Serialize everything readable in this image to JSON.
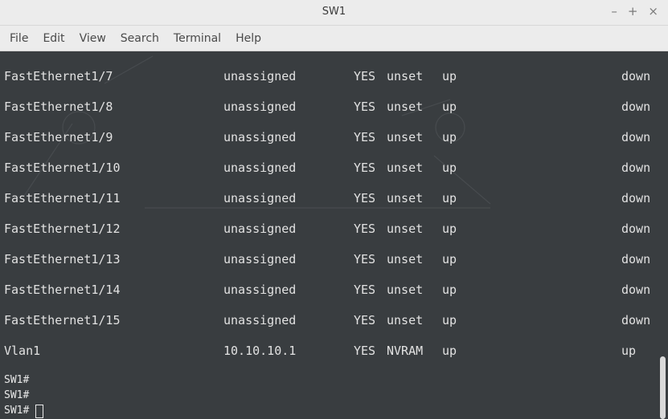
{
  "window": {
    "title": "SW1",
    "controls": {
      "minimize": "–",
      "maximize": "+",
      "close": "×"
    }
  },
  "menu": {
    "file": "File",
    "edit": "Edit",
    "view": "View",
    "search": "Search",
    "terminal": "Terminal",
    "help": "Help"
  },
  "interfaces": [
    {
      "interface": "FastEthernet1/7",
      "ip": "unassigned",
      "ok": "YES",
      "method": "unset",
      "status": "up",
      "protocol": "down"
    },
    {
      "interface": "FastEthernet1/8",
      "ip": "unassigned",
      "ok": "YES",
      "method": "unset",
      "status": "up",
      "protocol": "down"
    },
    {
      "interface": "FastEthernet1/9",
      "ip": "unassigned",
      "ok": "YES",
      "method": "unset",
      "status": "up",
      "protocol": "down"
    },
    {
      "interface": "FastEthernet1/10",
      "ip": "unassigned",
      "ok": "YES",
      "method": "unset",
      "status": "up",
      "protocol": "down"
    },
    {
      "interface": "FastEthernet1/11",
      "ip": "unassigned",
      "ok": "YES",
      "method": "unset",
      "status": "up",
      "protocol": "down"
    },
    {
      "interface": "FastEthernet1/12",
      "ip": "unassigned",
      "ok": "YES",
      "method": "unset",
      "status": "up",
      "protocol": "down"
    },
    {
      "interface": "FastEthernet1/13",
      "ip": "unassigned",
      "ok": "YES",
      "method": "unset",
      "status": "up",
      "protocol": "down"
    },
    {
      "interface": "FastEthernet1/14",
      "ip": "unassigned",
      "ok": "YES",
      "method": "unset",
      "status": "up",
      "protocol": "down"
    },
    {
      "interface": "FastEthernet1/15",
      "ip": "unassigned",
      "ok": "YES",
      "method": "unset",
      "status": "up",
      "protocol": "down"
    },
    {
      "interface": "Vlan1",
      "ip": "10.10.10.1",
      "ok": "YES",
      "method": "NVRAM",
      "status": "up",
      "protocol": "up"
    }
  ],
  "prompts": [
    "SW1#",
    "SW1#",
    "SW1#"
  ],
  "colors": {
    "terminal_bg": "#393d40",
    "terminal_fg": "#e2e2e2",
    "chrome_bg": "#ececec"
  }
}
